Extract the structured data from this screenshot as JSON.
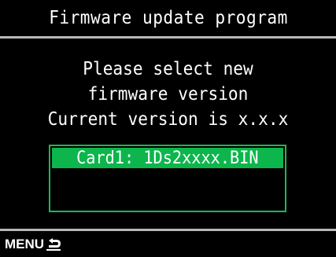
{
  "header": {
    "title": "Firmware update program"
  },
  "message": {
    "line1": "Please select new",
    "line2": "firmware version",
    "line3": "Current version is x.x.x"
  },
  "file_list": {
    "items": [
      {
        "label": "Card1: 1Ds2xxxx.BIN",
        "selected": true
      }
    ]
  },
  "footer": {
    "menu_label": "MENU",
    "back_icon": "return-arrow-icon"
  },
  "colors": {
    "background": "#000000",
    "selection": "#0cb64c",
    "list_border": "#1fb556",
    "divider": "#b8b8b8",
    "text": "#ffffff"
  }
}
